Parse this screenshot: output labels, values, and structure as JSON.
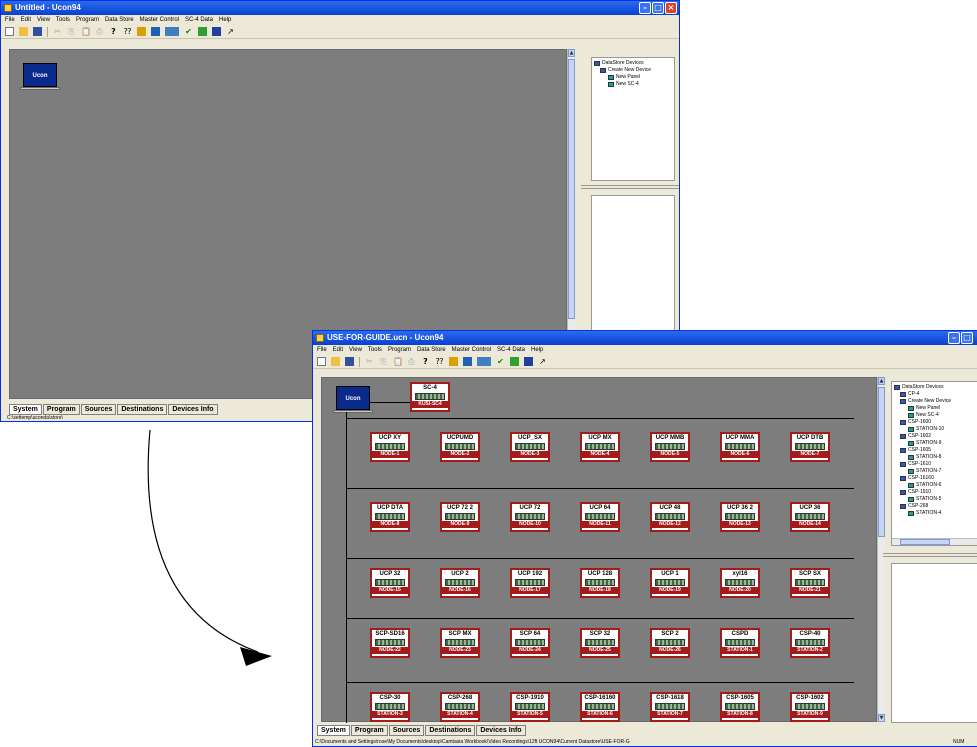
{
  "window1": {
    "title": "Untitled - Ucon94",
    "menu": [
      "File",
      "Edit",
      "View",
      "Tools",
      "Program",
      "Data Store",
      "Master Control",
      "SC-4 Data",
      "Help"
    ],
    "laptop_label": "Ucon",
    "tabs": [
      "System",
      "Program",
      "Sources",
      "Destinations",
      "Devices Info"
    ],
    "status": "C:\\settemp\\uconda\\store\\",
    "tree": [
      {
        "label": "DataStore Devices",
        "icon": "datastore-icon"
      },
      {
        "label": "Create New Device",
        "icon": "datastore-icon"
      },
      {
        "label": "New Panel",
        "icon": "panel-icon"
      },
      {
        "label": "New SC-4",
        "icon": "panel-icon"
      }
    ]
  },
  "window2": {
    "title": "USE-FOR-GUIDE.ucn - Ucon94",
    "menu": [
      "File",
      "Edit",
      "View",
      "Tools",
      "Program",
      "Data Store",
      "Master Control",
      "SC-4 Data",
      "Help"
    ],
    "laptop_label": "Ucon",
    "top_device": {
      "name": "SC-4",
      "node": "KUSI-SC4"
    },
    "rows": [
      [
        {
          "name": "UCP XY",
          "node": "NODE-1"
        },
        {
          "name": "UCPUMD",
          "node": "NODE-2"
        },
        {
          "name": "UCP_SX",
          "node": "NODE-3"
        },
        {
          "name": "UCP MX",
          "node": "NODE-4"
        },
        {
          "name": "UCP MMB",
          "node": "NODE-5"
        },
        {
          "name": "UCP MMA",
          "node": "NODE-6"
        },
        {
          "name": "UCP DTB",
          "node": "NODE-7"
        }
      ],
      [
        {
          "name": "UCP DTA",
          "node": "NODE-8"
        },
        {
          "name": "UCP 72 2",
          "node": "NODE-9"
        },
        {
          "name": "UCP 72",
          "node": "NODE-10"
        },
        {
          "name": "UCP 64",
          "node": "NODE-11"
        },
        {
          "name": "UCP 48",
          "node": "NODE-12"
        },
        {
          "name": "UCP 36 2",
          "node": "NODE-13"
        },
        {
          "name": "UCP 36",
          "node": "NODE-14"
        }
      ],
      [
        {
          "name": "UCP 32",
          "node": "NODE-15"
        },
        {
          "name": "UCP 2",
          "node": "NODE-16"
        },
        {
          "name": "UCP 192",
          "node": "NODE-17"
        },
        {
          "name": "UCP 128",
          "node": "NODE-18"
        },
        {
          "name": "UCP 1",
          "node": "NODE-19"
        },
        {
          "name": "xyl16",
          "node": "NODE-20"
        },
        {
          "name": "SCP SX",
          "node": "NODE-21"
        }
      ],
      [
        {
          "name": "SCP-SD16",
          "node": "NODE-22"
        },
        {
          "name": "SCP MX",
          "node": "NODE-23"
        },
        {
          "name": "SCP 64",
          "node": "NODE-24"
        },
        {
          "name": "SCP 32",
          "node": "NODE-25"
        },
        {
          "name": "SCP 2",
          "node": "NODE-26"
        },
        {
          "name": "CSPD",
          "node": "STATION-1"
        },
        {
          "name": "CSP-40",
          "node": "STATION-2"
        }
      ],
      [
        {
          "name": "CSP-30",
          "node": "STATION-3"
        },
        {
          "name": "CSP-268",
          "node": "STATION-4"
        },
        {
          "name": "CSP-1910",
          "node": "STATION-5"
        },
        {
          "name": "CSP-16160",
          "node": "STATION-6"
        },
        {
          "name": "CSP-1618",
          "node": "STATION-7"
        },
        {
          "name": "CSP-1605",
          "node": "STATION-8"
        },
        {
          "name": "CSP-1602",
          "node": "STATION-9"
        }
      ]
    ],
    "tabs": [
      "System",
      "Program",
      "Sources",
      "Destinations",
      "Devices Info"
    ],
    "status": "C:\\Documents and Settings\\rose\\My Documents\\desktop\\Camtasia Workbook\\Video Recordings\\12ft UCON94\\Current Datastore\\USE-FOR-G",
    "status_right": "NUM",
    "tree": [
      {
        "label": "DataStore Devices",
        "icon": "datastore-icon"
      },
      {
        "label": "CP-4",
        "icon": "datastore-icon"
      },
      {
        "label": "Create New Device",
        "icon": "datastore-icon"
      },
      {
        "label": "New Panel",
        "icon": "panel-icon"
      },
      {
        "label": "New SC-4",
        "icon": "panel-icon"
      },
      {
        "label": "CSP-1600",
        "icon": "datastore-icon"
      },
      {
        "label": "STATION-10",
        "icon": "panel-icon"
      },
      {
        "label": "CSP-1602",
        "icon": "datastore-icon"
      },
      {
        "label": "STATION-9",
        "icon": "panel-icon"
      },
      {
        "label": "CSP-1605",
        "icon": "datastore-icon"
      },
      {
        "label": "STATION-8",
        "icon": "panel-icon"
      },
      {
        "label": "CSP-1610",
        "icon": "datastore-icon"
      },
      {
        "label": "STATION-7",
        "icon": "panel-icon"
      },
      {
        "label": "CSP-16160",
        "icon": "datastore-icon"
      },
      {
        "label": "STATION-6",
        "icon": "panel-icon"
      },
      {
        "label": "CSP-1910",
        "icon": "datastore-icon"
      },
      {
        "label": "STATION-5",
        "icon": "panel-icon"
      },
      {
        "label": "CSP-268",
        "icon": "datastore-icon"
      },
      {
        "label": "STATION-4",
        "icon": "panel-icon"
      }
    ]
  },
  "colors": {
    "device_border": "#a31b1b",
    "canvas": "#7d7d7d",
    "titlebar": "#0a3fcf",
    "laptop_screen": "#0a2a8c"
  }
}
